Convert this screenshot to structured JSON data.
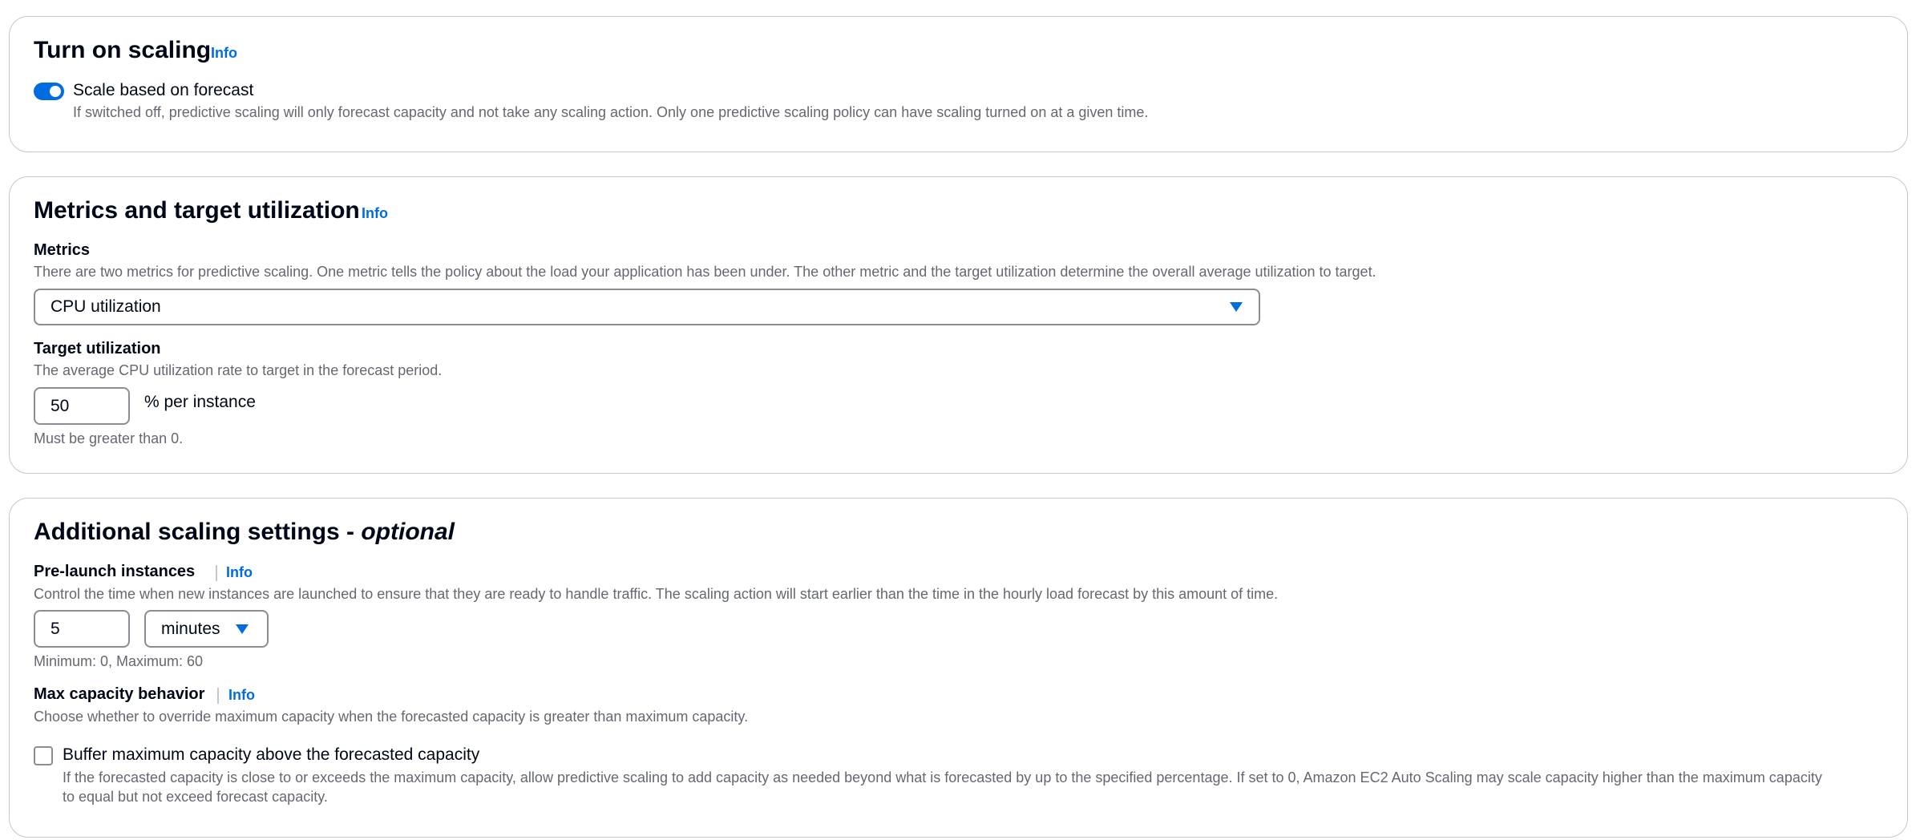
{
  "scaling": {
    "title": "Turn on scaling",
    "info": "Info",
    "toggle_label": "Scale based on forecast",
    "toggle_on": true,
    "toggle_description": "If switched off, predictive scaling will only forecast capacity and not take any scaling action. Only one predictive scaling policy can have scaling turned on at a given time."
  },
  "metrics_section": {
    "title": "Metrics and target utilization",
    "info": "Info",
    "metrics_label": "Metrics",
    "metrics_description": "There are two metrics for predictive scaling. One metric tells the policy about the load your application has been under. The other metric and the target utilization determine the overall average utilization to target.",
    "metrics_selected": "CPU utilization",
    "target_label": "Target utilization",
    "target_description": "The average CPU utilization rate to target in the forecast period.",
    "target_value": "50",
    "target_unit": "% per instance",
    "target_constraint": "Must be greater than 0."
  },
  "additional": {
    "title": "Additional scaling settings - ",
    "title_optional": "optional",
    "prelaunch_label": "Pre-launch instances",
    "prelaunch_info": "Info",
    "prelaunch_description": "Control the time when new instances are launched to ensure that they are ready to handle traffic. The scaling action will start earlier than the time in the hourly load forecast by this amount of time.",
    "prelaunch_value": "5",
    "prelaunch_unit": "minutes",
    "prelaunch_constraint": "Minimum: 0, Maximum: 60",
    "maxcap_label": "Max capacity behavior",
    "maxcap_info": "Info",
    "maxcap_description": "Choose whether to override maximum capacity when the forecasted capacity is greater than maximum capacity.",
    "buffer_label": "Buffer maximum capacity above the forecasted capacity",
    "buffer_checked": false,
    "buffer_description_line1": "If the forecasted capacity is close to or exceeds the maximum capacity, allow predictive scaling to add capacity as needed beyond what is forecasted by up to the specified percentage. If set to 0, Amazon EC2 Auto Scaling may scale capacity higher than the maximum capacity",
    "buffer_description_line2": "to equal but not exceed forecast capacity."
  },
  "colors": {
    "accent": "#006ce0",
    "text": "#000716",
    "secondary_text": "#656871",
    "border": "#c6c6cd",
    "input_border": "#8c8c94"
  },
  "icons": {
    "dropdown": "caret-down-icon",
    "toggle": "toggle-switch",
    "checkbox": "checkbox"
  }
}
